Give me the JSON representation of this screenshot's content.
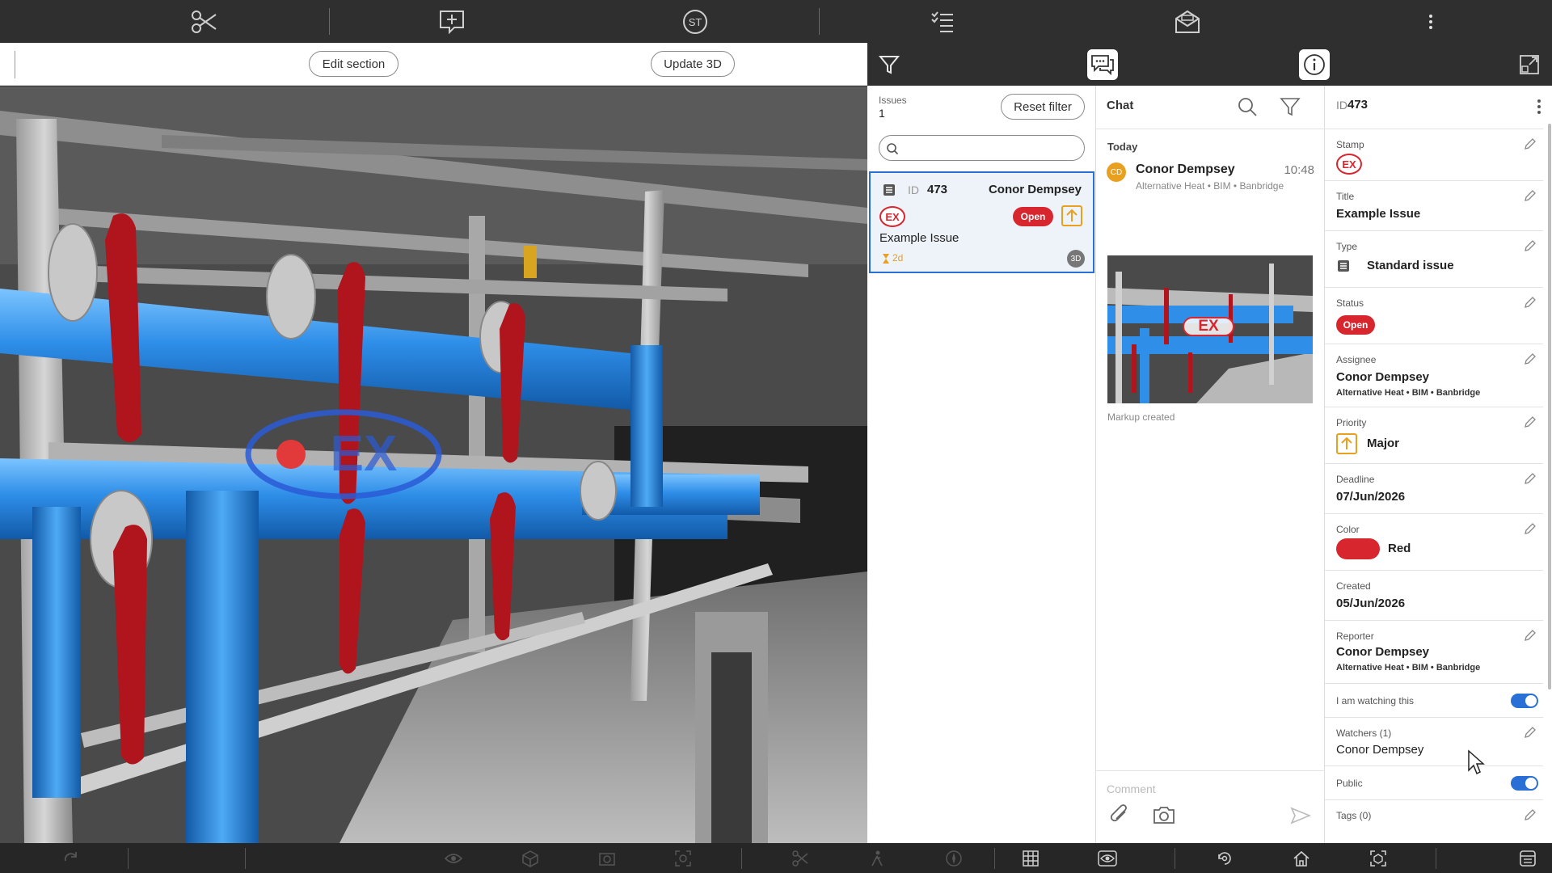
{
  "topbar": {
    "icons": [
      "scissors-icon",
      "add-comment-icon",
      "user-initials-badge",
      "checklist-icon",
      "inbox-mail-icon",
      "more-vertical-icon"
    ],
    "user_initials": "ST"
  },
  "viewer": {
    "edit_section_label": "Edit section",
    "update_3d_label": "Update 3D",
    "markup_stamp_text": "EX"
  },
  "right_header": {
    "icons": [
      "filter-icon",
      "chat-icon",
      "info-icon",
      "expand-icon"
    ]
  },
  "issues": {
    "label": "Issues",
    "count": "1",
    "reset_filter_label": "Reset filter",
    "search_placeholder": "",
    "items": [
      {
        "id_label": "ID",
        "id": "473",
        "assignee": "Conor Dempsey",
        "stamp": "EX",
        "status": "Open",
        "title": "Example Issue",
        "due": "2d",
        "model_badge": "3D"
      }
    ]
  },
  "chat": {
    "title": "Chat",
    "day_label": "Today",
    "message": {
      "avatar_initials": "CD",
      "author": "Conor Dempsey",
      "time": "10:48",
      "meta": "Alternative Heat • BIM • Banbridge",
      "image_stamp": "EX",
      "caption": "Markup created"
    },
    "comment_placeholder": "Comment"
  },
  "details": {
    "id_label": "ID",
    "id": "473",
    "stamp_label": "Stamp",
    "stamp": "EX",
    "title_label": "Title",
    "title": "Example Issue",
    "type_label": "Type",
    "type": "Standard issue",
    "status_label": "Status",
    "status": "Open",
    "assignee_label": "Assignee",
    "assignee": "Conor Dempsey",
    "assignee_meta": "Alternative Heat • BIM • Banbridge",
    "priority_label": "Priority",
    "priority": "Major",
    "deadline_label": "Deadline",
    "deadline": "07/Jun/2026",
    "color_label": "Color",
    "color_name": "Red",
    "color_value": "#d8262f",
    "created_label": "Created",
    "created": "05/Jun/2026",
    "reporter_label": "Reporter",
    "reporter": "Conor Dempsey",
    "reporter_meta": "Alternative Heat • BIM • Banbridge",
    "watching_label": "I am watching this",
    "watching": true,
    "watchers_label": "Watchers (1)",
    "watchers": "Conor Dempsey",
    "public_label": "Public",
    "public": true,
    "tags_label": "Tags (0)"
  },
  "bottombar": {
    "icons": [
      "redo-icon",
      "eye-icon",
      "cube-icon",
      "camera-cube-icon",
      "focus-icon",
      "scissors-icon",
      "person-walk-icon",
      "compass-icon",
      "grid-icon",
      "view-eye-icon",
      "rotate-icon",
      "home-icon",
      "fit-view-icon",
      "window-icon"
    ]
  },
  "colors": {
    "accent": "#2a6fd6",
    "danger": "#d8262f",
    "warning": "#e8a020",
    "toolbar": "#2f2f2f"
  }
}
